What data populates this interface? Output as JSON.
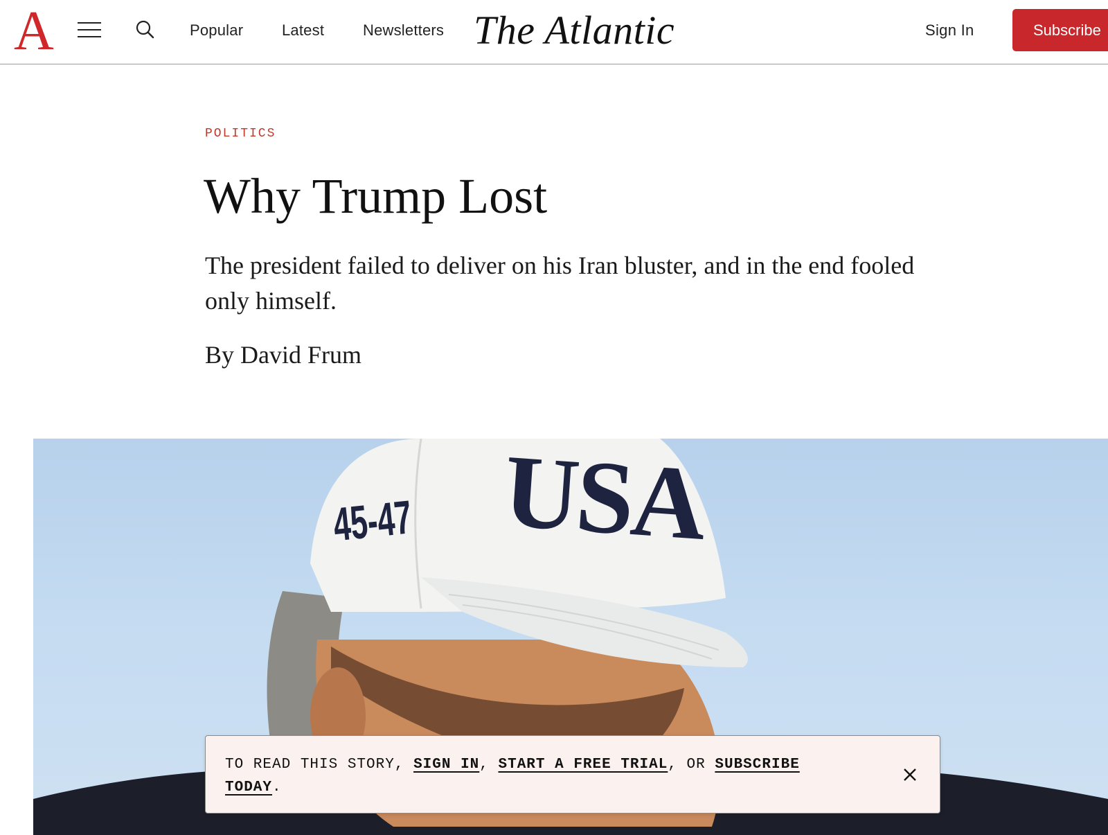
{
  "header": {
    "logo_letter": "A",
    "nav": [
      "Popular",
      "Latest",
      "Newsletters"
    ],
    "wordmark": "The Atlantic",
    "sign_in": "Sign In",
    "subscribe": "Subscribe"
  },
  "icons": {
    "menu": "hamburger-menu-icon",
    "search": "search-icon",
    "close": "close-icon"
  },
  "article": {
    "section": "POLITICS",
    "headline": "Why Trump Lost",
    "dek": "The president failed to deliver on his Iran bluster, and in the end fooled only himself.",
    "byline_prefix": "By",
    "author": "David Frum"
  },
  "hero": {
    "cap_front_text": "USA",
    "cap_side_text": "45-47"
  },
  "paywall": {
    "prefix": "TO READ THIS STORY,",
    "sign_in": "SIGN IN",
    "comma1": ",",
    "trial": "START A FREE TRIAL",
    "or": ", OR",
    "subscribe": "SUBSCRIBE TODAY",
    "period": "."
  },
  "colors": {
    "brand_red": "#c8282b",
    "section_red": "#c0392b",
    "paywall_bg": "#fbf2ef",
    "sky": "#c4dbf1"
  }
}
